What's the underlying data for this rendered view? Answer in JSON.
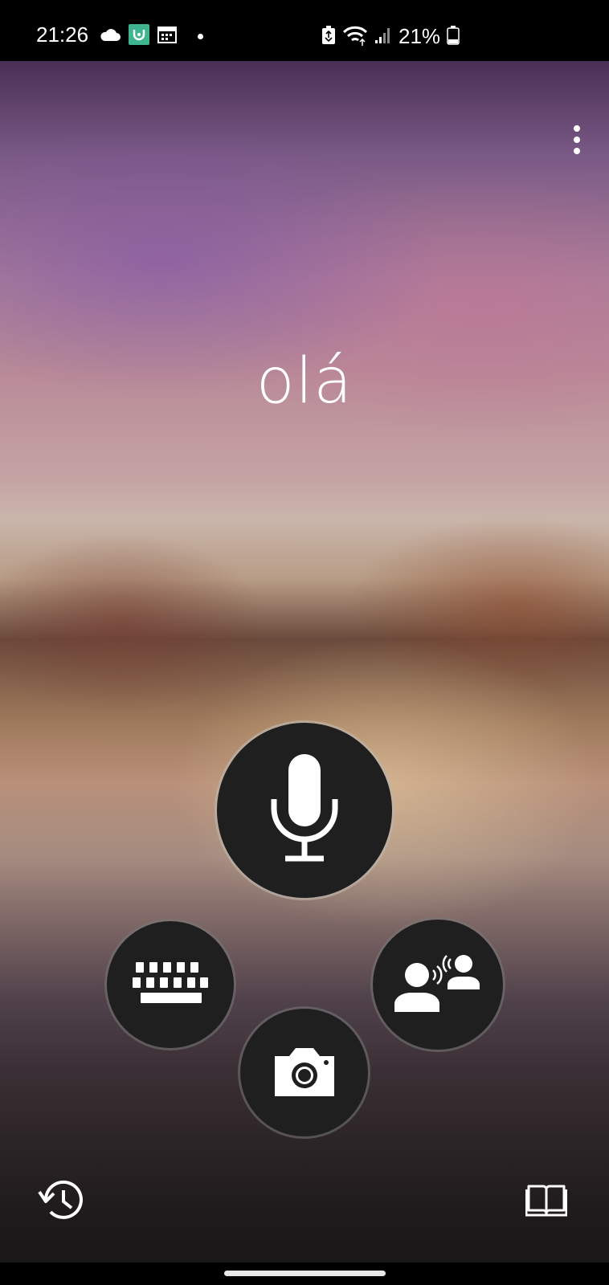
{
  "status_bar": {
    "time": "21:26",
    "battery": "21%",
    "left_icons": [
      "cloud-icon",
      "mi-app-icon",
      "calendar-icon",
      "notification-dot"
    ],
    "right_icons": [
      "battery-saver-icon",
      "wifi-icon",
      "signal-icon",
      "battery-icon"
    ]
  },
  "header": {
    "menu_icon": "more-vertical-icon"
  },
  "translation": {
    "text": "olá"
  },
  "actions": {
    "mic_icon": "microphone-icon",
    "keyboard_icon": "keyboard-icon",
    "conversation_icon": "conversation-icon",
    "camera_icon": "camera-icon"
  },
  "footer": {
    "history_icon": "history-icon",
    "phrasebook_icon": "phrasebook-icon"
  },
  "colors": {
    "button_fill": "#1f1f1f",
    "icon": "#ffffff",
    "status_bar": "#000000",
    "mi_app_badge": "#3fb58f"
  }
}
